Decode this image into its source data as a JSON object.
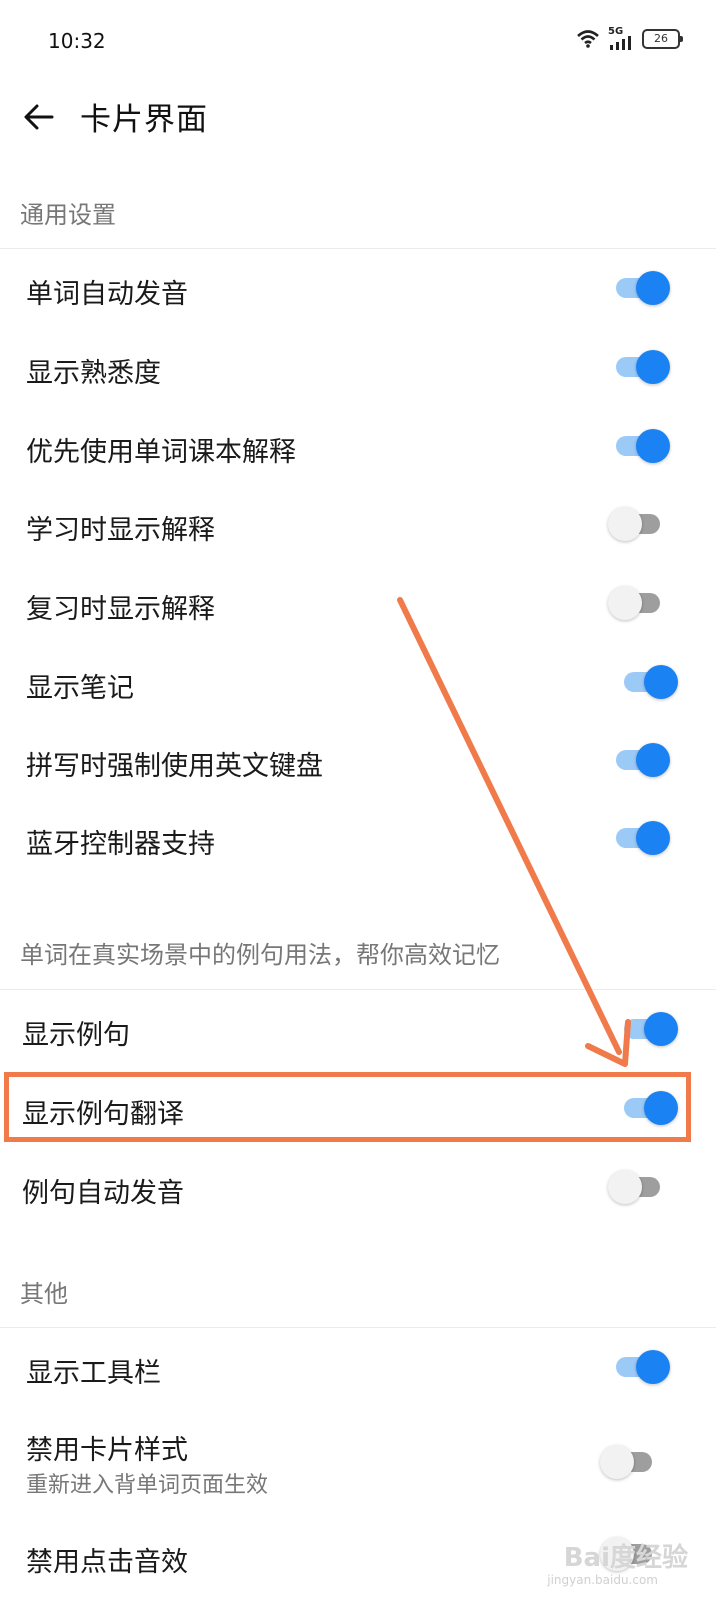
{
  "status_bar": {
    "time": "10:32",
    "network": "5G",
    "battery": "26",
    "icons": [
      "wifi-icon",
      "signal-icon",
      "battery-icon"
    ]
  },
  "header": {
    "back_icon": "arrow-left-icon",
    "title": "卡片界面"
  },
  "sections": {
    "general": {
      "title": "通用设置",
      "items": [
        {
          "label": "单词自动发音",
          "on": true
        },
        {
          "label": "显示熟悉度",
          "on": true
        },
        {
          "label": "优先使用单词课本解释",
          "on": true
        },
        {
          "label": "学习时显示解释",
          "on": false
        },
        {
          "label": "复习时显示解释",
          "on": false
        },
        {
          "label": "显示笔记",
          "on": true
        },
        {
          "label": "拼写时强制使用英文键盘",
          "on": true
        },
        {
          "label": "蓝牙控制器支持",
          "on": true
        }
      ]
    },
    "examples": {
      "title": "单词在真实场景中的例句用法，帮你高效记忆",
      "items": [
        {
          "label": "显示例句",
          "on": true
        },
        {
          "label": "显示例句翻译",
          "on": true,
          "highlighted": true
        },
        {
          "label": "例句自动发音",
          "on": false
        }
      ]
    },
    "other": {
      "title": "其他",
      "items": [
        {
          "label": "显示工具栏",
          "on": true
        },
        {
          "label": "禁用卡片样式",
          "subtitle": "重新进入背单词页面生效",
          "on": false
        },
        {
          "label": "禁用点击音效",
          "on": false
        }
      ]
    }
  },
  "annotation": {
    "color": "#f07a4a",
    "target": "显示例句翻译"
  },
  "colors": {
    "toggle_on_thumb": "#1a82f2",
    "toggle_on_track": "#9ccaf7",
    "toggle_off_thumb": "#f2f2f2",
    "toggle_off_track": "#9e9e9e"
  },
  "watermark": {
    "text": "Bai度经验",
    "sub": "jingyan.baidu.com"
  }
}
